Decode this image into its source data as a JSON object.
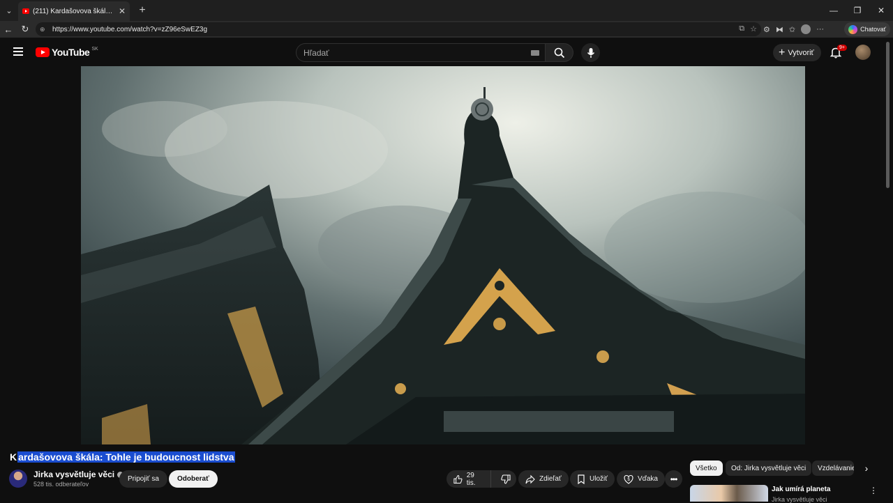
{
  "browser": {
    "tab_title": "(211) Kardašovova škála: Tohle je budoucnost lidstva - YouTube",
    "url": "https://www.youtube.com/watch?v=zZ96eSwEZ3g",
    "copilot_label": "Chatovať"
  },
  "header": {
    "logo_word": "YouTube",
    "country": "SK",
    "search_placeholder": "Hľadať",
    "create_label": "Vytvoriť",
    "notification_badge": "9+"
  },
  "video": {
    "title_first": "K",
    "title_rest": "ardašovova škála: Tohle je budoucnost lidstva"
  },
  "channel": {
    "name": "Jirka vysvětluje věci",
    "subscribers": "528 tis. odberateľov",
    "join_label": "Pripojiť sa",
    "subscribe_label": "Odoberať"
  },
  "actions": {
    "likes": "29 tis.",
    "share_label": "Zdieľať",
    "save_label": "Uložiť",
    "thanks_label": "Vďaka"
  },
  "chips": [
    {
      "label": "Všetko"
    },
    {
      "label": "Od: Jirka vysvětluje věci"
    },
    {
      "label": "Vzdelávanie"
    }
  ],
  "recommendation": {
    "title": "Jak umírá planeta",
    "channel": "Jirka vysvětluje věci"
  },
  "colors": {
    "brand_red": "#ff0000",
    "background": "#0f0f0f",
    "selection_blue": "#1a4dd0"
  }
}
